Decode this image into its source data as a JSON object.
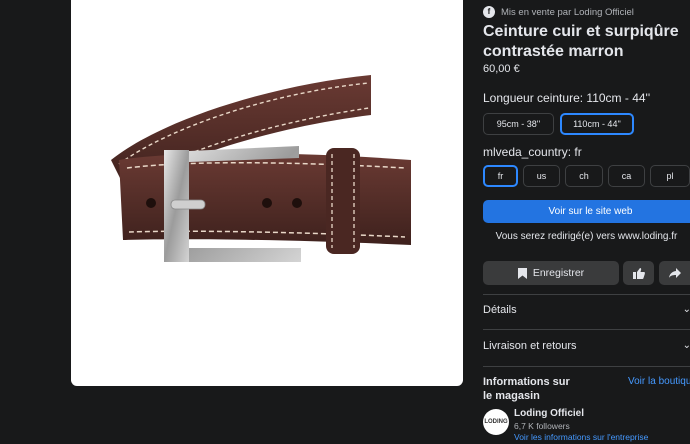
{
  "seller": {
    "label": "Mis en vente par Loding Officiel"
  },
  "product": {
    "title": "Ceinture cuir et surpiqûre contrastée marron",
    "price": "60,00 €"
  },
  "length_option": {
    "label": "Longueur ceinture:",
    "selected": "110cm - 44''",
    "choices": [
      "95cm - 38''",
      "110cm - 44''"
    ]
  },
  "country_option": {
    "label": "mlveda_country:",
    "selected": "fr",
    "choices": [
      "fr",
      "us",
      "ch",
      "ca",
      "pl"
    ]
  },
  "cta": {
    "label": "Voir sur le site web",
    "redirect": "Vous serez redirigé(e) vers www.loding.fr"
  },
  "actions": {
    "save_label": "Enregistrer",
    "like_icon": "thumbs-up-icon",
    "share_icon": "share-icon"
  },
  "sections": {
    "details": "Détails",
    "shipping": "Livraison et retours"
  },
  "store": {
    "heading": "Informations sur le magasin",
    "link": "Voir la boutique",
    "avatar_text": "LODING",
    "name": "Loding Officiel",
    "followers": "6,7 K followers",
    "info_link": "Voir les informations sur l'entreprise"
  },
  "colors": {
    "background": "#18191a",
    "accent": "#2374e1",
    "selected_border": "#2d88ff",
    "link": "#4599ff"
  }
}
